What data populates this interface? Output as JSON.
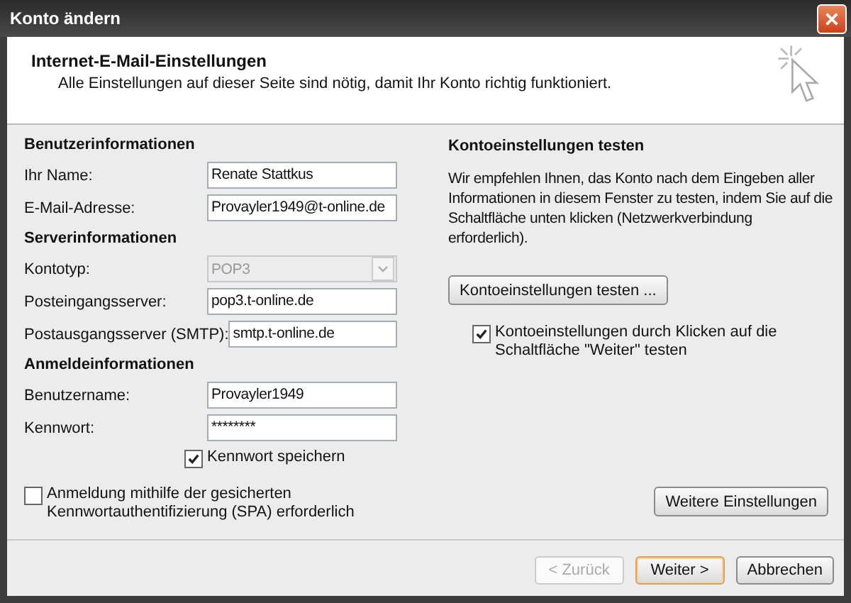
{
  "window": {
    "title": "Konto ändern"
  },
  "header": {
    "title": "Internet-E-Mail-Einstellungen",
    "subtitle": "Alle Einstellungen auf dieser Seite sind nötig, damit Ihr Konto richtig funktioniert."
  },
  "left_sections": [
    {
      "heading": "Benutzerinformationen",
      "fields": [
        {
          "label": "Ihr Name:",
          "value": "Renate Stattkus",
          "kind": "text",
          "disabled": false
        },
        {
          "label": "E-Mail-Adresse:",
          "value": "Provayler1949@t-online.de",
          "kind": "text",
          "disabled": false
        }
      ]
    },
    {
      "heading": "Serverinformationen",
      "fields": [
        {
          "label": "Kontotyp:",
          "value": "POP3",
          "kind": "dropdown",
          "disabled": true
        },
        {
          "label": "Posteingangsserver:",
          "value": "pop3.t-online.de",
          "kind": "text",
          "disabled": false
        },
        {
          "label": "Postausgangsserver (SMTP):",
          "value": "smtp.t-online.de",
          "kind": "text",
          "disabled": false
        }
      ]
    },
    {
      "heading": "Anmeldeinformationen",
      "fields": [
        {
          "label": "Benutzername:",
          "value": "Provayler1949",
          "kind": "text",
          "disabled": false
        },
        {
          "label": "Kennwort:",
          "value": "********",
          "kind": "text",
          "disabled": false
        }
      ]
    }
  ],
  "remember_password": {
    "label": "Kennwort speichern",
    "checked": true
  },
  "spa": {
    "label": "Anmeldung mithilfe der gesicherten Kennwortauthentifizierung (SPA) erforderlich",
    "checked": false
  },
  "test": {
    "heading": "Kontoeinstellungen testen",
    "description": "Wir empfehlen Ihnen, das Konto nach dem Eingeben aller Informationen in diesem Fenster zu testen, indem Sie auf die Schaltfläche unten klicken (Netzwerkverbindung erforderlich).",
    "button": "Kontoeinstellungen testen ...",
    "test_on_next": {
      "label": "Kontoeinstellungen durch Klicken auf die Schaltfläche \"Weiter\" testen",
      "checked": true
    }
  },
  "more_settings_button": "Weitere Einstellungen",
  "footer_buttons": [
    {
      "label": "< Zurück",
      "disabled": true,
      "default": false
    },
    {
      "label": "Weiter >",
      "disabled": false,
      "default": true
    },
    {
      "label": "Abbrechen",
      "disabled": false,
      "default": false
    }
  ]
}
